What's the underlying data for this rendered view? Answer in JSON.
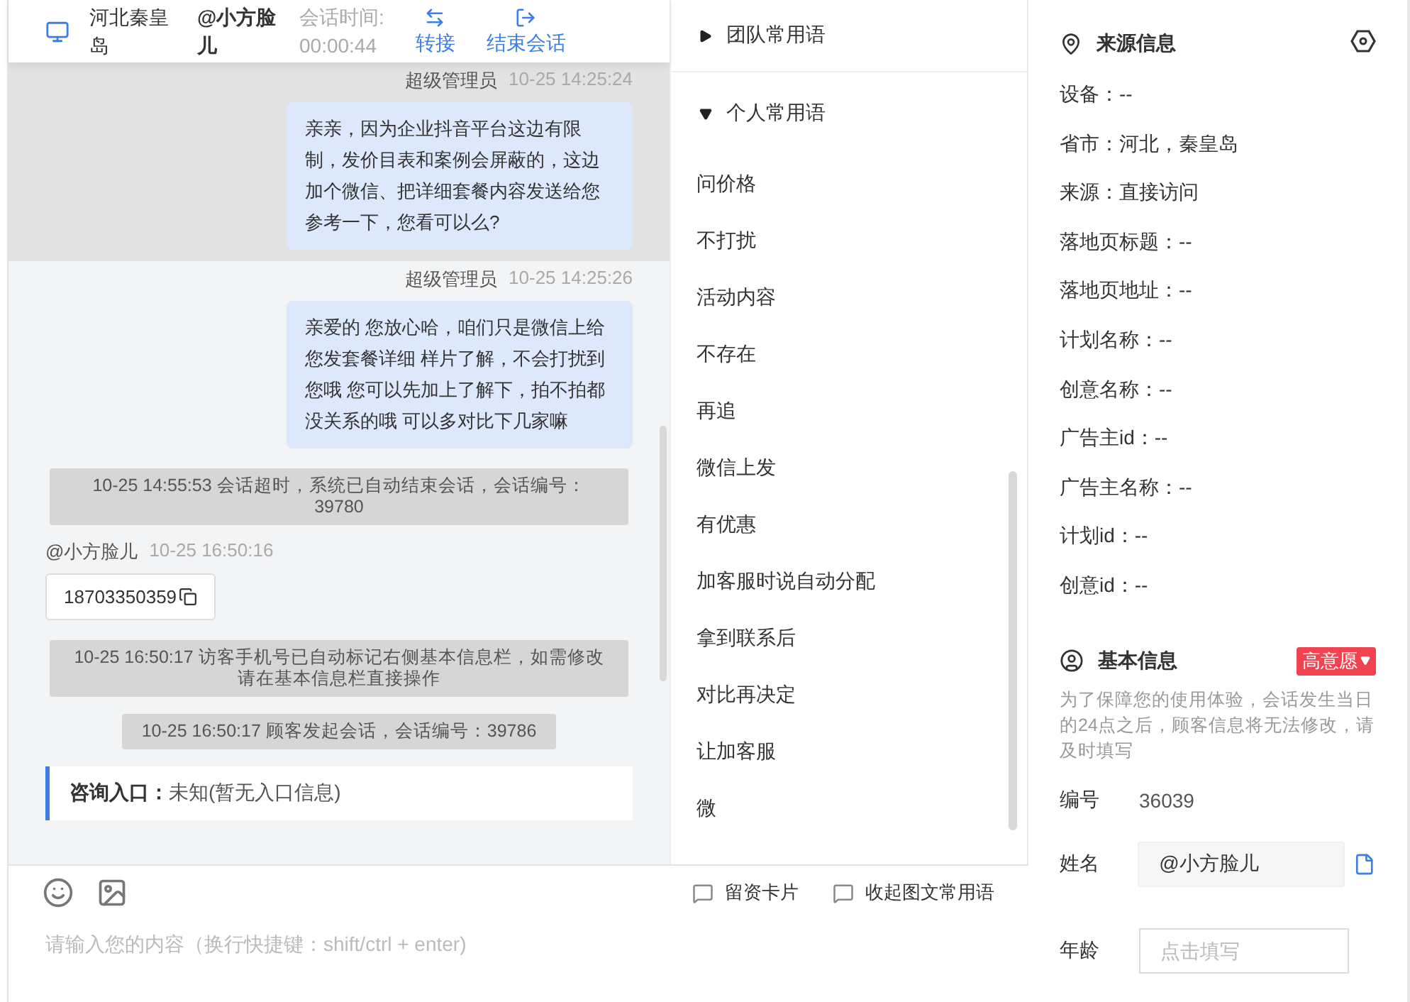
{
  "header": {
    "location": "河北秦皇岛",
    "visitor": "@小方脸儿",
    "timer_label": "会话时间:",
    "timer": "00:00:44",
    "actions": [
      {
        "label": "转接",
        "kind": "transfer"
      },
      {
        "label": "结束会话",
        "kind": "end"
      }
    ]
  },
  "messages": [
    {
      "kind": "agent",
      "sender": "超级管理员",
      "time": "10-25 14:25:24",
      "text": "亲亲，因为企业抖音平台这边有限制，发价目表和案例会屏蔽的，这边加个微信、把详细套餐内容发送给您参考一下，您看可以么?",
      "highlighted": true
    },
    {
      "kind": "agent",
      "sender": "超级管理员",
      "time": "10-25 14:25:26",
      "text": "亲爱的 您放心哈，咱们只是微信上给您发套餐详细 样片了解，不会打扰到您哦 您可以先加上了解下，拍不拍都没关系的哦 可以多对比下几家嘛",
      "highlighted": false
    },
    {
      "kind": "system",
      "text": "10-25 14:55:53 会话超时，系统已自动结束会话，会话编号：39780"
    },
    {
      "kind": "visitor",
      "sender": "@小方脸儿",
      "time": "10-25 16:50:16",
      "text": "18703350359"
    },
    {
      "kind": "system",
      "text": "10-25 16:50:17 访客手机号已自动标记右侧基本信息栏，如需修改请在基本信息栏直接操作"
    },
    {
      "kind": "system",
      "text": "10-25 16:50:17 顾客发起会话，会话编号：39786"
    },
    {
      "kind": "entry",
      "label": "咨询入口：",
      "value": "未知(暂无入口信息)"
    }
  ],
  "composer": {
    "tools": [
      {
        "label": "留资卡片"
      },
      {
        "label": "收起图文常用语"
      }
    ],
    "placeholder": "请输入您的内容（换行快捷键：shift/ctrl + enter)"
  },
  "phrases": [
    {
      "title": "团队常用语",
      "expanded": false
    },
    {
      "title": "个人常用语",
      "expanded": true,
      "items": [
        "问价格",
        "不打扰",
        "活动内容",
        "不存在",
        "再追",
        "微信上发",
        "有优惠",
        "加客服时说自动分配",
        "拿到联系后",
        "对比再决定",
        "让加客服",
        "微"
      ]
    }
  ],
  "source_info": {
    "title": "来源信息",
    "fields": [
      "设备：--",
      "省市：河北，秦皇岛",
      "来源：直接访问",
      "落地页标题：--",
      "落地页地址：--",
      "计划名称：--",
      "创意名称：--",
      "广告主id：--",
      "广告主名称：--",
      "计划id：--",
      "创意id：--"
    ]
  },
  "basic_info": {
    "title": "基本信息",
    "intent": "高意愿",
    "note": "为了保障您的使用体验，会话发生当日的24点之后，顾客信息将无法修改，请及时填写",
    "rows": [
      {
        "kind": "text",
        "label": "编号",
        "value": "36039"
      },
      {
        "kind": "copy_field",
        "label": "姓名",
        "value": "@小方脸儿"
      },
      {
        "kind": "input",
        "label": "年龄",
        "placeholder": "点击填写"
      }
    ]
  }
}
